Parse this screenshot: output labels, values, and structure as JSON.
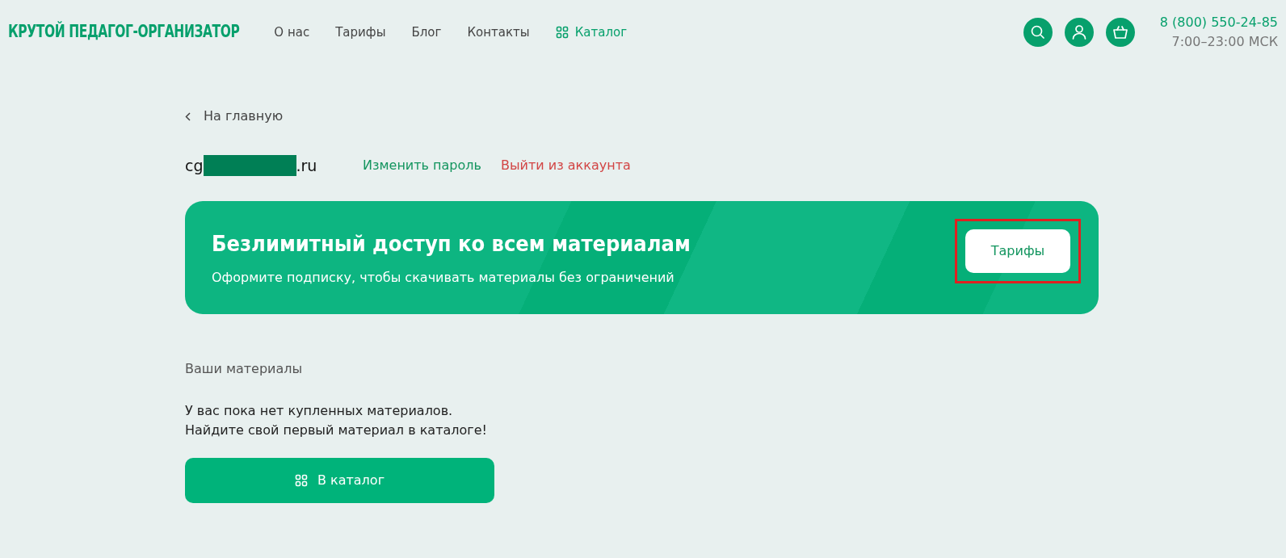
{
  "header": {
    "logo": "КРУТОЙ ПЕДАГОГ-ОРГАНИЗАТОР",
    "nav": [
      {
        "label": "О нас",
        "kind": "link"
      },
      {
        "label": "Тарифы",
        "kind": "link"
      },
      {
        "label": "Блог",
        "kind": "link"
      },
      {
        "label": "Контакты",
        "kind": "link"
      },
      {
        "label": "Каталог",
        "kind": "catalog"
      }
    ],
    "actions": [
      {
        "kind": "search"
      },
      {
        "kind": "user"
      },
      {
        "kind": "cart"
      }
    ],
    "phone": "8 (800) 550-24-85",
    "hours": "7:00–23:00 МСК"
  },
  "back_link": "На главную",
  "account": {
    "email_start": "cg",
    "email_end": ".ru",
    "redacted": true,
    "change_password": "Изменить пароль",
    "logout": "Выйти из аккаунта"
  },
  "banner": {
    "title": "Безлимитный доступ ко всем материалам",
    "subtitle": "Оформите подписку, чтобы скачивать материалы без ограничений",
    "button": {
      "label": "Тарифы",
      "highlighted": true
    }
  },
  "materials": {
    "heading": "Ваши материалы",
    "empty_lines": [
      "У вас пока нет купленных материалов.",
      "Найдите свой первый материал в каталоге!"
    ],
    "button": "В каталог"
  }
}
